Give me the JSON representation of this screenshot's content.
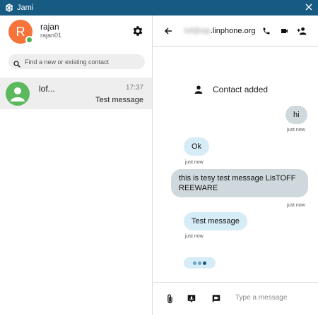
{
  "window": {
    "title": "Jami"
  },
  "account": {
    "avatar_letter": "R",
    "name": "rajan",
    "id": "rajan01"
  },
  "search": {
    "placeholder": "Find a new or existing contact"
  },
  "conversations": [
    {
      "name": "lof...",
      "time": "17:37",
      "last_message": "Test message"
    }
  ],
  "chat": {
    "peer_masked": "lof@sip",
    "peer_domain": ".linphone.org",
    "system_message": "Contact added",
    "messages": [
      {
        "direction": "out",
        "text": "hi",
        "timestamp": "just now"
      },
      {
        "direction": "in",
        "text": "Ok",
        "timestamp": "just now"
      },
      {
        "direction": "out",
        "text": "this is tesy test message LisTOFF REEWARE",
        "timestamp": "just now"
      },
      {
        "direction": "in",
        "text": "Test message",
        "timestamp": "just now"
      }
    ]
  },
  "composer": {
    "placeholder": "Type a message"
  },
  "colors": {
    "titlebar": "#175b83",
    "avatar": "#f4743c",
    "contact_avatar": "#5cb85c",
    "presence": "#4caf50",
    "incoming_bubble": "#d6ecf7",
    "outgoing_bubble": "#cfd8dc"
  }
}
